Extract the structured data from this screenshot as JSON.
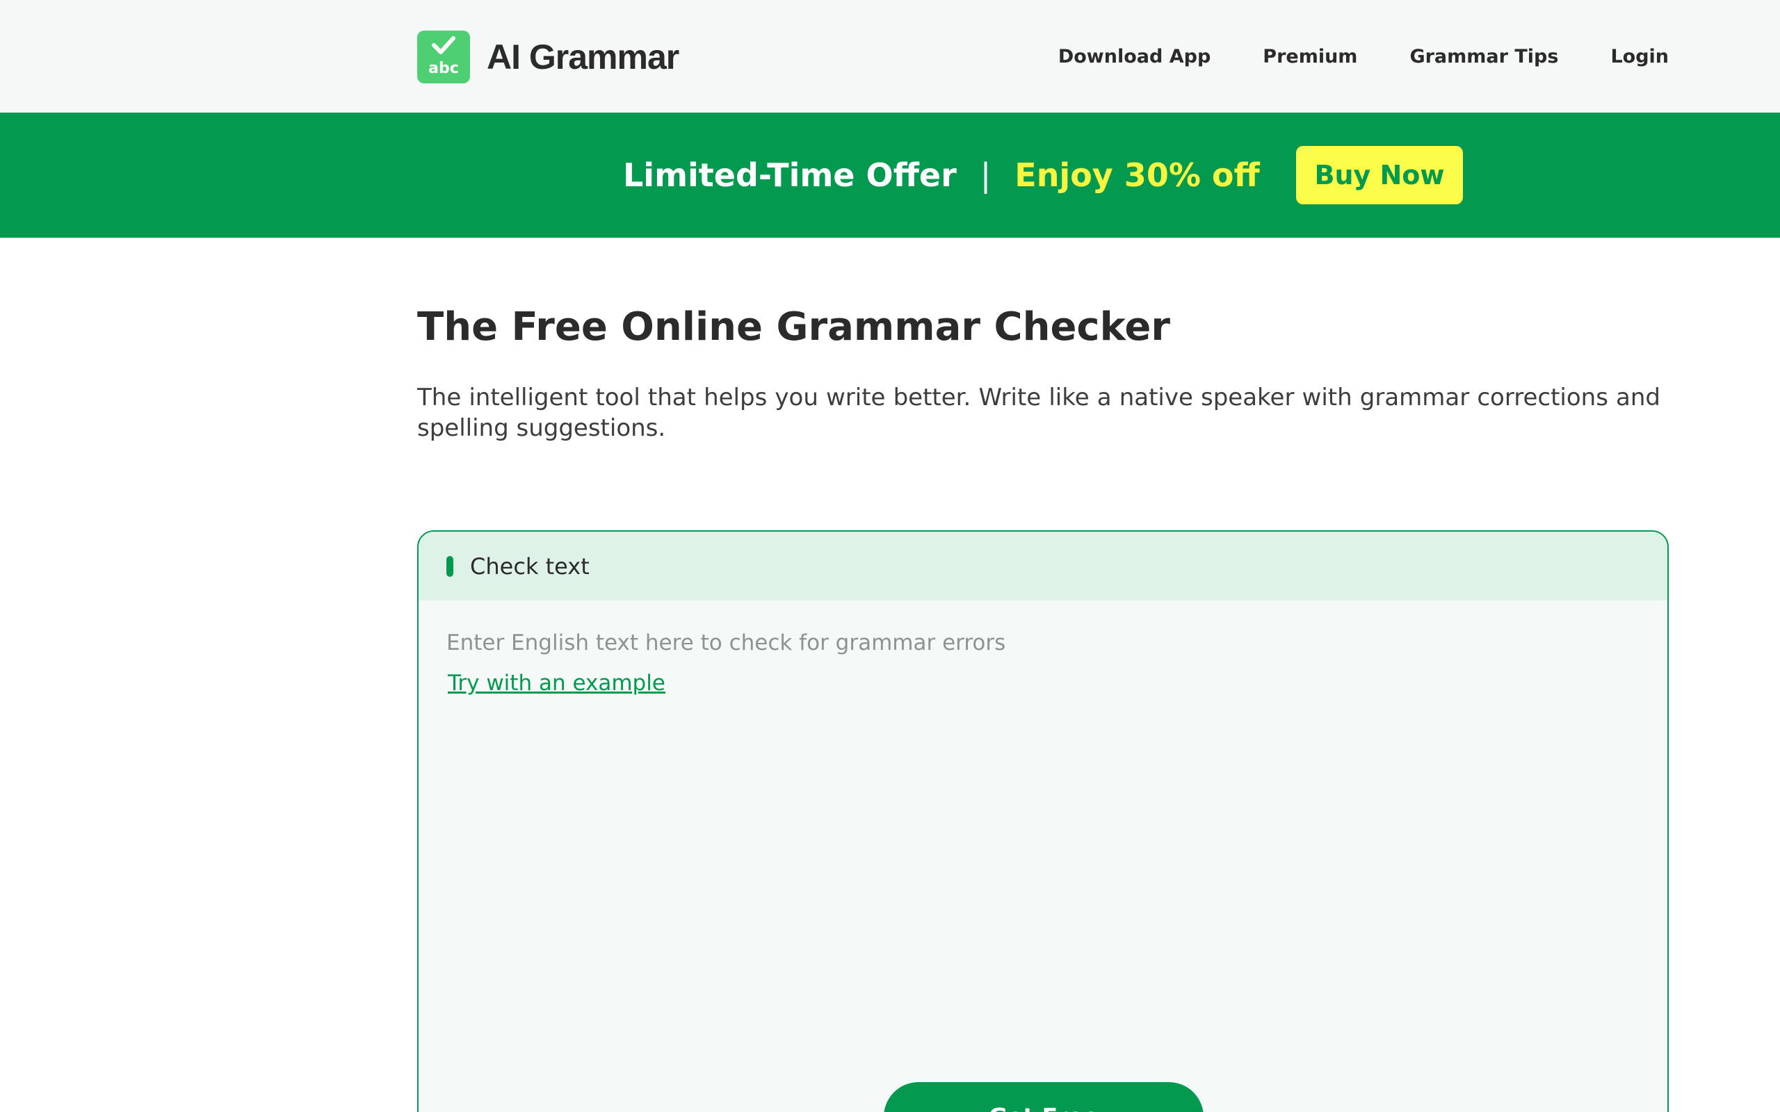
{
  "header": {
    "logo": {
      "icon": "checkmark-icon",
      "mark_text": "abc",
      "name": "AI Grammar"
    },
    "nav": [
      {
        "label": "Download App"
      },
      {
        "label": "Premium"
      },
      {
        "label": "Grammar Tips"
      },
      {
        "label": "Login"
      }
    ]
  },
  "promo": {
    "offer": "Limited-Time Offer",
    "separator": "|",
    "deal": "Enjoy 30% off",
    "button": "Buy Now"
  },
  "main": {
    "title": "The Free Online Grammar Checker",
    "description": "The intelligent tool that helps you write better. Write like a native speaker with grammar corrections and spelling suggestions.",
    "checker": {
      "heading": "Check text",
      "placeholder": "Enter English text here to check for grammar errors",
      "example_link": "Try with an example",
      "submit_button": "Get Free"
    }
  },
  "colors": {
    "brand_green": "#039a50",
    "logo_green": "#4fcf73",
    "promo_yellow": "#f5f542",
    "button_yellow": "#fbfb4a",
    "checker_header_bg": "#def2e8"
  }
}
